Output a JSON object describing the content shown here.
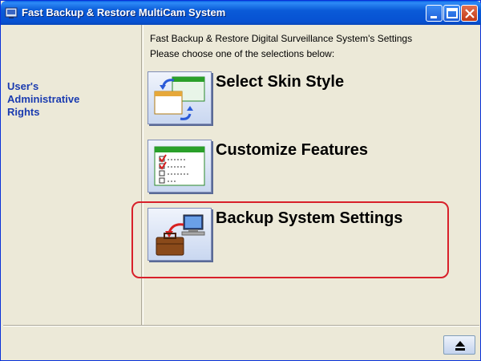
{
  "window": {
    "title": "Fast Backup & Restore MultiCam System"
  },
  "sidebar": {
    "rights_label": "User's Administrative Rights"
  },
  "main": {
    "header_line1": "Fast Backup & Restore Digital Surveillance System's Settings",
    "header_line2": "Please choose one of the selections below:",
    "options": [
      {
        "label": "Select Skin Style",
        "icon": "skin-style-icon"
      },
      {
        "label": "Customize Features",
        "icon": "customize-features-icon"
      },
      {
        "label": "Backup System Settings",
        "icon": "backup-settings-icon",
        "highlighted": true
      }
    ]
  },
  "footer": {
    "eject_icon": "eject-icon"
  },
  "colors": {
    "titlebar": "#0a5bd8",
    "rights_label": "#1a3bb0",
    "highlight_border": "#d8202a",
    "background": "#ece9d8"
  }
}
